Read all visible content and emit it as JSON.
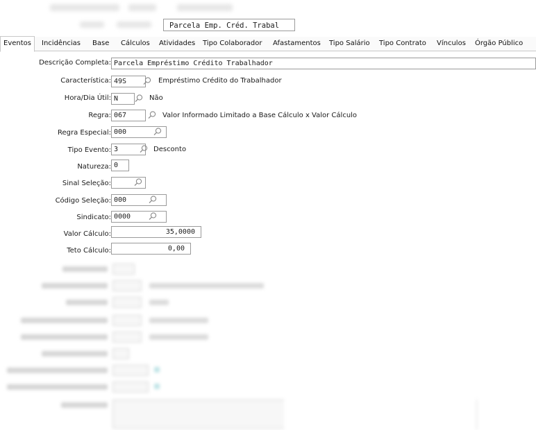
{
  "header": {
    "short_name": "Parcela Emp. Créd. Trabal"
  },
  "tabs": [
    {
      "label": "Eventos"
    },
    {
      "label": "Incidências"
    },
    {
      "label": "Base"
    },
    {
      "label": "Cálculos"
    },
    {
      "label": "Atividades"
    },
    {
      "label": "Tipo Colaborador"
    },
    {
      "label": "Afastamentos"
    },
    {
      "label": "Tipo Salário"
    },
    {
      "label": "Tipo Contrato"
    },
    {
      "label": "Vínculos"
    },
    {
      "label": "Órgão Público"
    }
  ],
  "form": {
    "descricao_completa": {
      "label": "Descrição Completa:",
      "value": "Parcela Empréstimo Crédito Trabalhador"
    },
    "caracteristica": {
      "label": "Característica:",
      "value": "49S",
      "desc": "Empréstimo Crédito do Trabalhador"
    },
    "hora_dia_util": {
      "label": "Hora/Dia Útil:",
      "value": "N",
      "desc": "Não"
    },
    "regra": {
      "label": "Regra:",
      "value": "067",
      "desc": "Valor Informado Limitado a Base Cálculo x Valor Cálculo"
    },
    "regra_especial": {
      "label": "Regra Especial:",
      "value": "000"
    },
    "tipo_evento": {
      "label": "Tipo Evento:",
      "value": "3",
      "desc": "Desconto"
    },
    "natureza": {
      "label": "Natureza:",
      "value": "0"
    },
    "sinal_selecao": {
      "label": "Sinal Seleção:",
      "value": ""
    },
    "codigo_selecao": {
      "label": "Código Seleção:",
      "value": "000"
    },
    "sindicato": {
      "label": "Sindicato:",
      "value": "0000"
    },
    "valor_calculo": {
      "label": "Valor Cálculo:",
      "value": "35,0000"
    },
    "teto_calculo": {
      "label": "Teto Cálculo:",
      "value": "0,00"
    }
  },
  "icons": {
    "lookup": "magnifier-icon"
  }
}
